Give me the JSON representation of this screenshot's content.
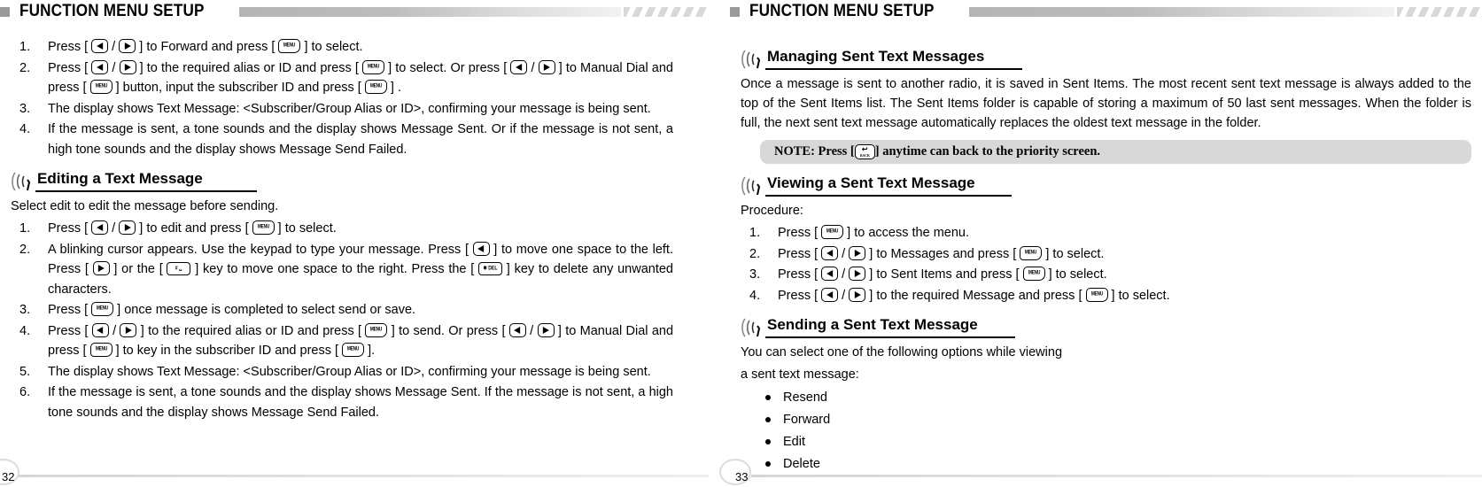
{
  "header": {
    "title": "FUNCTION MENU SETUP"
  },
  "left": {
    "steps_top": [
      {
        "num": "1.",
        "parts": [
          {
            "t": "text",
            "v": "Press [ "
          },
          {
            "t": "key",
            "v": "left-arrow"
          },
          {
            "t": "text",
            "v": " / "
          },
          {
            "t": "key",
            "v": "right-arrow"
          },
          {
            "t": "text",
            "v": " ] to Forward and press [ "
          },
          {
            "t": "key",
            "v": "menu"
          },
          {
            "t": "text",
            "v": " ] to select."
          }
        ]
      },
      {
        "num": "2.",
        "parts": [
          {
            "t": "text",
            "v": "Press [ "
          },
          {
            "t": "key",
            "v": "left-arrow"
          },
          {
            "t": "text",
            "v": " / "
          },
          {
            "t": "key",
            "v": "right-arrow"
          },
          {
            "t": "text",
            "v": " ] to the required alias or ID and press [ "
          },
          {
            "t": "key",
            "v": "menu"
          },
          {
            "t": "text",
            "v": " ] to select. Or press  [ "
          },
          {
            "t": "key",
            "v": "left-arrow"
          },
          {
            "t": "text",
            "v": " / "
          },
          {
            "t": "key",
            "v": "right-arrow"
          },
          {
            "t": "text",
            "v": " ] to Manual Dial and press [ "
          },
          {
            "t": "key",
            "v": "menu"
          },
          {
            "t": "text",
            "v": " ] button, input the subscriber ID and press [ "
          },
          {
            "t": "key",
            "v": "menu"
          },
          {
            "t": "text",
            "v": " ] ."
          }
        ]
      },
      {
        "num": "3.",
        "parts": [
          {
            "t": "text",
            "v": "The display shows Text Message: <Subscriber/Group Alias or ID>, confirming your message is being sent."
          }
        ]
      },
      {
        "num": "4.",
        "parts": [
          {
            "t": "text",
            "v": "If the message is sent, a tone sounds and the display shows Message Sent. Or if the message is not sent, a high tone sounds and the display shows Message Send Failed."
          }
        ]
      }
    ],
    "section": {
      "title": "Editing a Text Message"
    },
    "intro": "Select edit to edit the message before sending.",
    "steps_bottom": [
      {
        "num": "1.",
        "parts": [
          {
            "t": "text",
            "v": "Press [ "
          },
          {
            "t": "key",
            "v": "left-arrow"
          },
          {
            "t": "text",
            "v": " / "
          },
          {
            "t": "key",
            "v": "right-arrow"
          },
          {
            "t": "text",
            "v": " ] to edit and press [ "
          },
          {
            "t": "key",
            "v": "menu"
          },
          {
            "t": "text",
            "v": " ] to select."
          }
        ]
      },
      {
        "num": "2.",
        "parts": [
          {
            "t": "text",
            "v": "A blinking cursor appears. Use the keypad to type your message. Press [ "
          },
          {
            "t": "key",
            "v": "left-arrow"
          },
          {
            "t": "text",
            "v": " ] to move one space to the left. Press [ "
          },
          {
            "t": "key",
            "v": "right-arrow"
          },
          {
            "t": "text",
            "v": " ]  or the [ "
          },
          {
            "t": "key",
            "v": "hash-space"
          },
          {
            "t": "text",
            "v": " ]  key to move one space to the right. Press the [ "
          },
          {
            "t": "key",
            "v": "star-del"
          },
          {
            "t": "text",
            "v": " ] key to delete any unwanted characters."
          }
        ]
      },
      {
        "num": "3.",
        "parts": [
          {
            "t": "text",
            "v": "Press [ "
          },
          {
            "t": "key",
            "v": "menu"
          },
          {
            "t": "text",
            "v": " ] once message is completed to select send or save."
          }
        ]
      },
      {
        "num": "4.",
        "parts": [
          {
            "t": "text",
            "v": "Press [ "
          },
          {
            "t": "key",
            "v": "left-arrow"
          },
          {
            "t": "text",
            "v": " / "
          },
          {
            "t": "key",
            "v": "right-arrow"
          },
          {
            "t": "text",
            "v": " ] to the required alias or ID and press [ "
          },
          {
            "t": "key",
            "v": "menu"
          },
          {
            "t": "text",
            "v": " ] to send. Or press [ "
          },
          {
            "t": "key",
            "v": "left-arrow"
          },
          {
            "t": "text",
            "v": " / "
          },
          {
            "t": "key",
            "v": "right-arrow"
          },
          {
            "t": "text",
            "v": " ] to Manual Dial and press [ "
          },
          {
            "t": "key",
            "v": "menu"
          },
          {
            "t": "text",
            "v": " ] to key in the subscriber ID and press [ "
          },
          {
            "t": "key",
            "v": "menu"
          },
          {
            "t": "text",
            "v": " ]."
          }
        ]
      },
      {
        "num": "5.",
        "parts": [
          {
            "t": "text",
            "v": "The display shows Text Message: <Subscriber/Group Alias or ID>, confirming your message is being sent."
          }
        ]
      },
      {
        "num": "6.",
        "parts": [
          {
            "t": "text",
            "v": "If the message is sent, a tone sounds and the display shows Message Sent. If the message is not sent, a high tone sounds and the display shows Message Send Failed."
          }
        ]
      }
    ],
    "page_number": "32"
  },
  "right": {
    "section_managing": {
      "title": "Managing Sent Text Messages"
    },
    "managing_body": "Once a message is sent to another radio, it is saved in Sent Items. The most recent sent text message is always added to the top of the Sent Items list. The Sent Items folder is capable of storing a maximum of 50 last sent messages. When the folder is full, the next sent text message automatically replaces the oldest text message in the folder.",
    "note": {
      "prefix": "NOTE:  Press [ ",
      "key": "back",
      "suffix": " ] anytime can back to the priority screen."
    },
    "section_viewing": {
      "title": "Viewing a Sent Text Message"
    },
    "procedure_label": "Procedure:",
    "viewing_steps": [
      {
        "num": "1.",
        "parts": [
          {
            "t": "text",
            "v": "Press [ "
          },
          {
            "t": "key",
            "v": "menu"
          },
          {
            "t": "text",
            "v": " ] to access the menu."
          }
        ]
      },
      {
        "num": "2.",
        "parts": [
          {
            "t": "text",
            "v": "Press [ "
          },
          {
            "t": "key",
            "v": "left-arrow"
          },
          {
            "t": "text",
            "v": " / "
          },
          {
            "t": "key",
            "v": "right-arrow"
          },
          {
            "t": "text",
            "v": " ] to Messages and press [ "
          },
          {
            "t": "key",
            "v": "menu"
          },
          {
            "t": "text",
            "v": " ] to select."
          }
        ]
      },
      {
        "num": "3.",
        "parts": [
          {
            "t": "text",
            "v": "Press [ "
          },
          {
            "t": "key",
            "v": "left-arrow"
          },
          {
            "t": "text",
            "v": " / "
          },
          {
            "t": "key",
            "v": "right-arrow"
          },
          {
            "t": "text",
            "v": " ] to Sent Items and press [ "
          },
          {
            "t": "key",
            "v": "menu"
          },
          {
            "t": "text",
            "v": " ] to select."
          }
        ]
      },
      {
        "num": "4.",
        "parts": [
          {
            "t": "text",
            "v": "Press [ "
          },
          {
            "t": "key",
            "v": "left-arrow"
          },
          {
            "t": "text",
            "v": " / "
          },
          {
            "t": "key",
            "v": "right-arrow"
          },
          {
            "t": "text",
            "v": " ] to the required Message and press [ "
          },
          {
            "t": "key",
            "v": "menu"
          },
          {
            "t": "text",
            "v": " ] to select."
          }
        ]
      }
    ],
    "section_sending": {
      "title": "Sending a Sent Text Message"
    },
    "sending_body_line1": "You can select one of the following options while viewing",
    "sending_body_line2": "a sent text message:",
    "options": [
      "Resend",
      "Forward",
      "Edit",
      "Delete"
    ],
    "page_number": "33"
  },
  "key_labels": {
    "menu": "MENU",
    "hash_space": "# ␣",
    "star_del": "✱ DEL",
    "back": "BACK"
  },
  "colors": {
    "header_square": "#9a9a9a",
    "header_bar_start": "#b4b4b4",
    "header_bar_end": "#f2f2f2",
    "note_background": "#d8d8d8",
    "text": "#000000"
  }
}
